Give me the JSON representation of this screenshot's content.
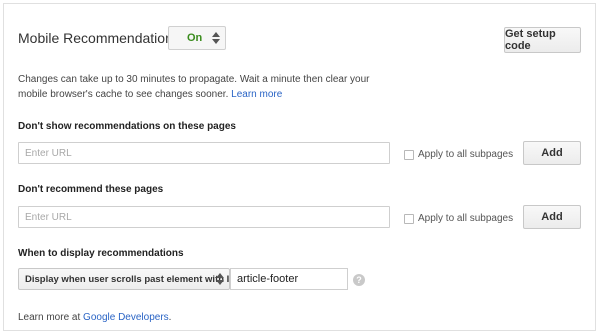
{
  "header": {
    "title": "Mobile Recommendations",
    "toggle_value": "On",
    "setup_button": "Get setup code"
  },
  "info": {
    "text": "Changes can take up to 30 minutes to propagate. Wait a minute then clear your mobile browser's cache to see changes sooner.",
    "link": "Learn more"
  },
  "exclude_pages": {
    "label": "Don't show recommendations on these pages",
    "placeholder": "Enter URL",
    "checkbox_label": "Apply to all subpages",
    "add_button": "Add"
  },
  "no_recommend_pages": {
    "label": "Don't recommend these pages",
    "placeholder": "Enter URL",
    "checkbox_label": "Apply to all subpages",
    "add_button": "Add"
  },
  "display": {
    "label": "When to display recommendations",
    "selected_option": "Display when user scrolls past element with ID",
    "element_id": "article-footer",
    "help_glyph": "?"
  },
  "footer": {
    "prefix": "Learn more at",
    "link": "Google Developers",
    "suffix": "."
  },
  "colors": {
    "toggle_on": "#3a8c1d",
    "link": "#2a64c5"
  }
}
